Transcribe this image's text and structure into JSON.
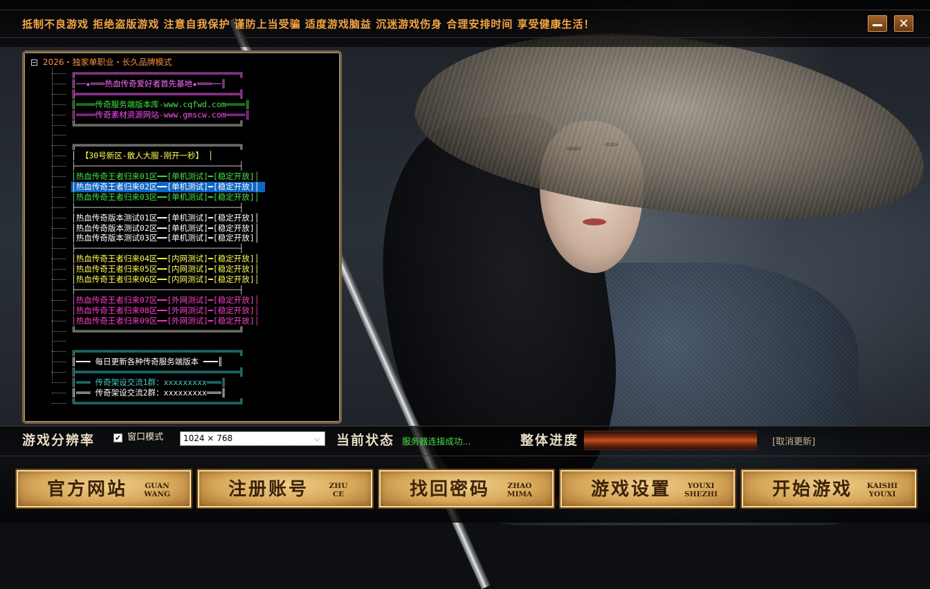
{
  "top_bar": {
    "slogan": "抵制不良游戏  拒绝盗版游戏  注意自我保护  谨防上当受骗  适度游戏脑益  沉迷游戏伤身  合理安排时间  享受健康生活！"
  },
  "server_tree": {
    "root_label": "2026・独家单职业・长久品牌模式",
    "rows": [
      {
        "text": "╔══════════════════════════════════╗",
        "color": "#ff66ff"
      },
      {
        "text": "║──★═══热血传奇爱好者首先基地★═══──║",
        "color": "#ff66ff"
      },
      {
        "text": "╠══════════════════════════════════╣",
        "color": "#ff66ff"
      },
      {
        "text": "║════传奇服务端版本库-www.cqfwd.com════║",
        "color": "#33e633"
      },
      {
        "text": "║════传奇素材资源网站-www.gmscw.com════║",
        "color": "#ff44ff"
      },
      {
        "text": "╚══════════════════════════════════╝",
        "color": "#cfcfcf"
      },
      {
        "text": "",
        "color": "#cfcfcf"
      },
      {
        "text": "╔══════════════════════════════════╗",
        "color": "#cfcfcf"
      },
      {
        "text": "│             【30号新区-散人大服-刚开一秒】           │",
        "color": "#ffff33"
      },
      {
        "text": "├──────────────────────────────────┤",
        "color": "#cfcfcf"
      },
      {
        "text": "│热血传奇王者归来01区━━[单机测试]━[稳定开放]│",
        "color": "#33e633"
      },
      {
        "text": "│热血传奇王者归来02区━━[单机测试]━[稳定开放]│",
        "color": "#33e633",
        "selected": true
      },
      {
        "text": "│热血传奇王者归来03区━━[单机测试]━[稳定开放]│",
        "color": "#33e633"
      },
      {
        "text": "├──────────────────────────────────┤",
        "color": "#cfcfcf"
      },
      {
        "text": "│热血传奇版本测试01区━━[单机测试]━[稳定开放]│",
        "color": "#ffffff"
      },
      {
        "text": "│热血传奇版本测试02区━━[单机测试]━[稳定开放]│",
        "color": "#ffffff"
      },
      {
        "text": "│热血传奇版本测试03区━━[单机测试]━[稳定开放]│",
        "color": "#ffffff"
      },
      {
        "text": "├──────────────────────────────────┤",
        "color": "#cfcfcf"
      },
      {
        "text": "│热血传奇王者归来04区━━[内网测试]━[稳定开放]│",
        "color": "#ffff33"
      },
      {
        "text": "│热血传奇王者归来05区━━[内网测试]━[稳定开放]│",
        "color": "#ffff33"
      },
      {
        "text": "│热血传奇王者归来06区━━[内网测试]━[稳定开放]│",
        "color": "#ffff33"
      },
      {
        "text": "├──────────────────────────────────┤",
        "color": "#cfcfcf"
      },
      {
        "text": "│热血传奇王者归来07区━━[外网测试]━[稳定开放]│",
        "color": "#ff33cc"
      },
      {
        "text": "│热血传奇王者归来08区━━[外网测试]━[稳定开放]│",
        "color": "#ff33cc"
      },
      {
        "text": "│热血传奇王者归来09区━━[外网测试]━[稳定开放]│",
        "color": "#ff33cc"
      },
      {
        "text": "╚══════════════════════════════════╝",
        "color": "#cfcfcf"
      },
      {
        "text": "",
        "color": "#cfcfcf"
      },
      {
        "text": "╔══════════════════════════════════╗",
        "color": "#33cccc"
      },
      {
        "text": "║━━━       每日更新各种传奇服务端版本        ━━━║",
        "color": "#ffffff"
      },
      {
        "text": "╠══════════════════════════════════╣",
        "color": "#33cccc"
      },
      {
        "text": "║═══      传奇架设交流1群：xxxxxxxxx═══║",
        "color": "#33cccc"
      },
      {
        "text": "║═══      传奇架设交流2群：xxxxxxxxx═══║",
        "color": "#ffffff"
      },
      {
        "text": "╚══════════════════════════════════╝",
        "color": "#33cccc"
      }
    ]
  },
  "status_bar": {
    "resolution_label": "游戏分辨率",
    "window_mode_label": "窗口模式",
    "window_mode_checked": true,
    "resolution_value": "1024 × 768",
    "status_label": "当前状态",
    "status_value": "服务器连接成功...",
    "progress_label": "整体进度",
    "progress_fraction": 0,
    "cancel_label": "[取消更新]"
  },
  "buttons": [
    {
      "label": "官方网站",
      "py1": "GUAN",
      "py2": "WANG"
    },
    {
      "label": "注册账号",
      "py1": "ZHU",
      "py2": "CE"
    },
    {
      "label": "找回密码",
      "py1": "ZHAO",
      "py2": "MIMA"
    },
    {
      "label": "游戏设置",
      "py1": "YOUXI",
      "py2": "SHEZHI"
    },
    {
      "label": "开始游戏",
      "py1": "KAISHI",
      "py2": "YOUXI"
    }
  ],
  "colors": {
    "slogan": "#f5a53a",
    "status_ok": "#3fe03a",
    "selection": "#0f64c8"
  }
}
